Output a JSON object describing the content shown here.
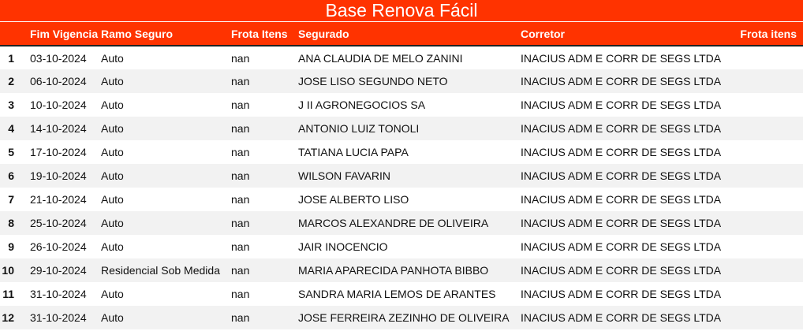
{
  "title": "Base Renova Fácil",
  "columns": [
    "",
    "Fim Vigencia",
    "Ramo Seguro",
    "Frota Itens",
    "Segurado",
    "Corretor",
    "Frota itens"
  ],
  "rows": [
    [
      "1",
      "03-10-2024",
      "Auto",
      "nan",
      "ANA CLAUDIA DE MELO ZANINI",
      "INACIUS ADM E CORR DE SEGS LTDA",
      ""
    ],
    [
      "2",
      "06-10-2024",
      "Auto",
      "nan",
      "JOSE LISO SEGUNDO NETO",
      "INACIUS ADM E CORR DE SEGS LTDA",
      ""
    ],
    [
      "3",
      "10-10-2024",
      "Auto",
      "nan",
      "J II AGRONEGOCIOS SA",
      "INACIUS ADM E CORR DE SEGS LTDA",
      ""
    ],
    [
      "4",
      "14-10-2024",
      "Auto",
      "nan",
      "ANTONIO LUIZ TONOLI",
      "INACIUS ADM E CORR DE SEGS LTDA",
      ""
    ],
    [
      "5",
      "17-10-2024",
      "Auto",
      "nan",
      "TATIANA LUCIA PAPA",
      "INACIUS ADM E CORR DE SEGS LTDA",
      ""
    ],
    [
      "6",
      "19-10-2024",
      "Auto",
      "nan",
      "WILSON FAVARIN",
      "INACIUS ADM E CORR DE SEGS LTDA",
      ""
    ],
    [
      "7",
      "21-10-2024",
      "Auto",
      "nan",
      "JOSE ALBERTO LISO",
      "INACIUS ADM E CORR DE SEGS LTDA",
      ""
    ],
    [
      "8",
      "25-10-2024",
      "Auto",
      "nan",
      "MARCOS ALEXANDRE DE OLIVEIRA",
      "INACIUS ADM E CORR DE SEGS LTDA",
      ""
    ],
    [
      "9",
      "26-10-2024",
      "Auto",
      "nan",
      "JAIR INOCENCIO",
      "INACIUS ADM E CORR DE SEGS LTDA",
      ""
    ],
    [
      "10",
      "29-10-2024",
      "Residencial Sob Medida",
      "nan",
      "MARIA APARECIDA PANHOTA BIBBO",
      "INACIUS ADM E CORR DE SEGS LTDA",
      ""
    ],
    [
      "11",
      "31-10-2024",
      "Auto",
      "nan",
      "SANDRA MARIA LEMOS DE ARANTES",
      "INACIUS ADM E CORR DE SEGS LTDA",
      ""
    ],
    [
      "12",
      "31-10-2024",
      "Auto",
      "nan",
      "JOSE FERREIRA ZEZINHO DE OLIVEIRA",
      "INACIUS ADM E CORR DE SEGS LTDA",
      ""
    ]
  ]
}
